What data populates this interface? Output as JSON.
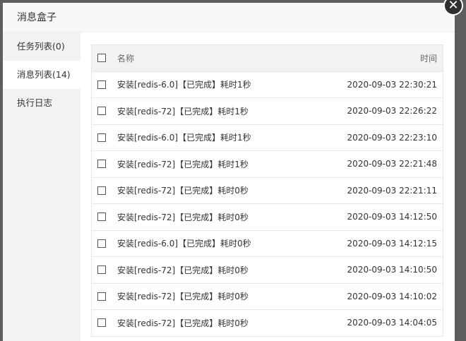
{
  "dialog": {
    "title": "消息盒子",
    "close_glyph": "✕"
  },
  "sidebar": {
    "items": [
      {
        "label": "任务列表(0)"
      },
      {
        "label": "消息列表(14)"
      },
      {
        "label": "执行日志"
      }
    ],
    "active": 1
  },
  "table": {
    "headers": {
      "name": "名称",
      "time": "时间"
    },
    "rows": [
      {
        "name": "安装[redis-6.0]【已完成】耗时1秒",
        "time": "2020-09-03 22:30:21"
      },
      {
        "name": "安装[redis-72]【已完成】耗时1秒",
        "time": "2020-09-03 22:26:22"
      },
      {
        "name": "安装[redis-6.0]【已完成】耗时1秒",
        "time": "2020-09-03 22:23:10"
      },
      {
        "name": "安装[redis-72]【已完成】耗时1秒",
        "time": "2020-09-03 22:21:48"
      },
      {
        "name": "安装[redis-72]【已完成】耗时0秒",
        "time": "2020-09-03 22:21:11"
      },
      {
        "name": "安装[redis-72]【已完成】耗时0秒",
        "time": "2020-09-03 14:12:50"
      },
      {
        "name": "安装[redis-6.0]【已完成】耗时0秒",
        "time": "2020-09-03 14:12:15"
      },
      {
        "name": "安装[redis-72]【已完成】耗时0秒",
        "time": "2020-09-03 14:10:50"
      },
      {
        "name": "安装[redis-72]【已完成】耗时0秒",
        "time": "2020-09-03 14:10:02"
      },
      {
        "name": "安装[redis-72]【已完成】耗时0秒",
        "time": "2020-09-03 14:04:05"
      }
    ]
  }
}
